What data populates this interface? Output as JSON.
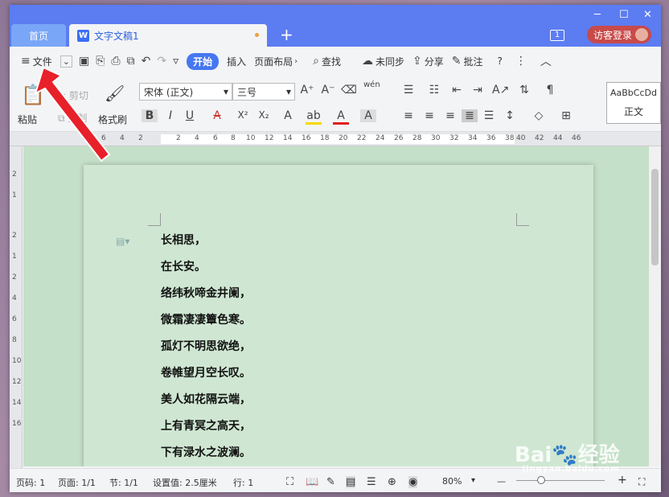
{
  "titlebar": {
    "home_tab": "首页",
    "doc_tab": "文字文稿1",
    "new_tab": "+",
    "badge": "1",
    "login": "访客登录",
    "min": "─",
    "max": "☐",
    "close": "✕"
  },
  "menubar": {
    "file": "文件",
    "start": "开始",
    "insert": "插入",
    "layout": "页面布局",
    "find": "查找",
    "sync": "未同步",
    "share": "分享",
    "comment": "批注",
    "help": "?"
  },
  "ribbon": {
    "paste": "粘贴",
    "cut": "剪切",
    "copy": "复制",
    "format_painter": "格式刷",
    "font_name": "宋体 (正文)",
    "font_size": "三号",
    "bold": "B",
    "italic": "I",
    "underline": "U",
    "strike": "A",
    "sup": "X²",
    "sub": "X₂",
    "style_preview": "AaBbCcDd",
    "style_name": "正文",
    "pinyin": "wén"
  },
  "ruler": {
    "ticks": [
      "6",
      "4",
      "2",
      "2",
      "4",
      "6",
      "8",
      "10",
      "12",
      "14",
      "16",
      "18",
      "20",
      "22",
      "24",
      "26",
      "28",
      "30",
      "32",
      "34",
      "36",
      "38",
      "40",
      "42",
      "44",
      "46"
    ]
  },
  "vruler": {
    "ticks": [
      "2",
      "1",
      "2",
      "1",
      "2",
      "4",
      "6",
      "8",
      "10",
      "12",
      "14",
      "16"
    ]
  },
  "poem": {
    "lines": [
      "长相思，",
      "在长安。",
      "络纬秋啼金井阑，",
      "微霜凄凄簟色寒。",
      "孤灯不明思欲绝，",
      "卷帷望月空长叹。",
      "美人如花隔云端，",
      "上有青冥之高天，",
      "下有渌水之波澜。"
    ]
  },
  "status": {
    "page": "页码: 1",
    "pages": "页面: 1/1",
    "section": "节: 1/1",
    "setting": "设置值: 2.5厘米",
    "row": "行: 1",
    "zoom": "80%",
    "minus": "—",
    "plus": "+"
  },
  "watermark": {
    "brand": "Bai",
    "brand2": "经验",
    "url": "jingyan.baidu.com"
  }
}
